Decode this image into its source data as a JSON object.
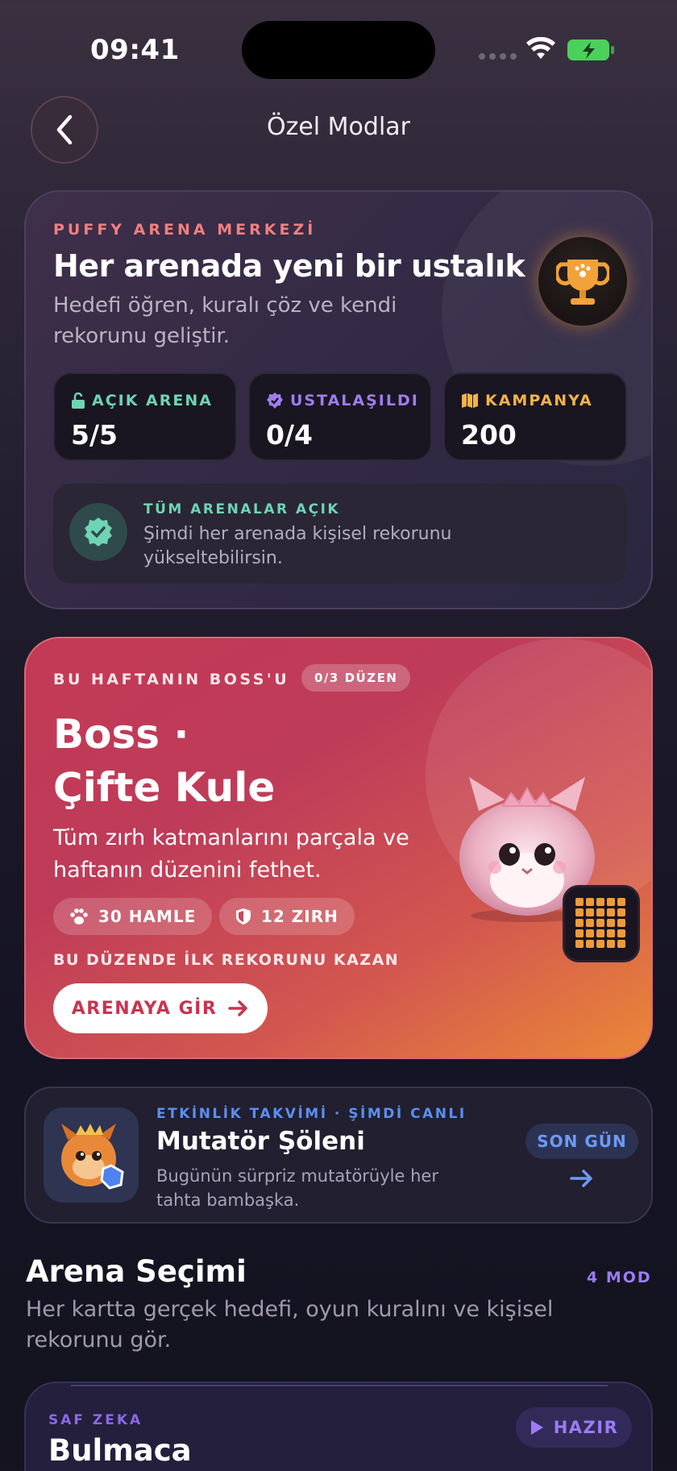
{
  "status_bar": {
    "time": "09:41"
  },
  "header": {
    "title": "Özel Modlar"
  },
  "hub": {
    "eyebrow": "PUFFY ARENA MERKEZİ",
    "title": "Her arenada yeni bir ustalık",
    "subtitle": "Hedefi öğren, kuralı çöz ve kendi rekorunu geliştir.",
    "stats": [
      {
        "label": "AÇIK ARENA",
        "value": "5/5",
        "color": "#6fd3b4",
        "icon": "unlock-icon"
      },
      {
        "label": "USTALAŞILDI",
        "value": "0/4",
        "color": "#a07cf0",
        "icon": "verified-badge-icon"
      },
      {
        "label": "KAMPANYA",
        "value": "200",
        "color": "#f3b24a",
        "icon": "map-icon"
      }
    ],
    "notice": {
      "title": "TÜM ARENALAR AÇIK",
      "text": "Şimdi her arenada kişisel rekorunu yükseltebilirsin."
    }
  },
  "boss": {
    "eyebrow": "BU HAFTANIN BOSS'U",
    "pill": "0/3 DÜZEN",
    "title_line1": "Boss ·",
    "title_line2": "Çifte Kule",
    "description": "Tüm zırh katmanlarını parçala ve haftanın düzenini fethet.",
    "chips": [
      {
        "label": "30 HAMLE",
        "icon": "paw-icon"
      },
      {
        "label": "12 ZIRH",
        "icon": "shield-icon"
      }
    ],
    "reward": "BU DÜZENDE İLK REKORUNU KAZAN",
    "button": "ARENAYA GİR"
  },
  "event": {
    "eyebrow": "ETKİNLİK TAKVİMİ · ŞİMDİ CANLI",
    "title": "Mutatör Şöleni",
    "description": "Bugünün sürpriz mutatörüyle her tahta bambaşka.",
    "badge": "SON GÜN"
  },
  "arena_selection": {
    "title": "Arena Seçimi",
    "count": "4 MOD",
    "subtitle": "Her kartta gerçek hedefi, oyun kuralını ve kişisel rekorunu gör.",
    "modes": [
      {
        "eyebrow": "SAF ZEKA",
        "title": "Bulmaca",
        "status": "HAZIR"
      }
    ]
  },
  "colors": {
    "accent_red": "#f07f80",
    "boss_gradient_start": "#c33a55",
    "boss_gradient_end": "#ea8838",
    "event_blue": "#5b8ff1",
    "mode_purple": "#8b69e8"
  }
}
